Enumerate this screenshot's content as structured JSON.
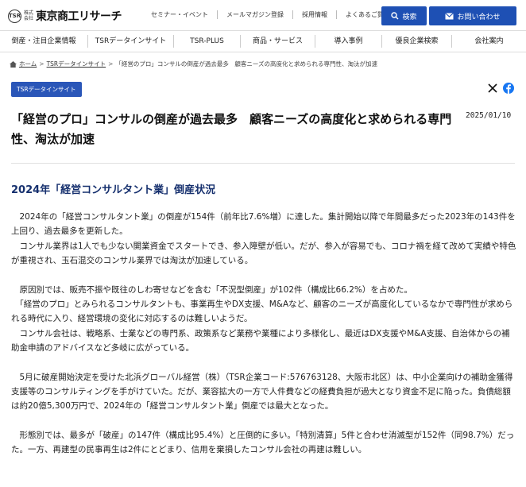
{
  "header": {
    "logo_mark": "TSR",
    "logo_small": "株式会社",
    "logo_text": "東京商工リサーチ",
    "links": [
      "セミナー・イベント",
      "メールマガジン登録",
      "採用情報",
      "よくあるご質問"
    ],
    "search_label": "検索",
    "contact_label": "お問い合わせ"
  },
  "nav": {
    "items": [
      "倒産・注目企業情報",
      "TSRデータインサイト",
      "TSR-PLUS",
      "商品・サービス",
      "導入事例",
      "優良企業検索",
      "会社案内"
    ]
  },
  "breadcrumb": {
    "home": "ホーム",
    "section": "TSRデータインサイト",
    "current": "「経営のプロ」コンサルの倒産が過去最多　顧客ニーズの高度化と求められる専門性、淘汰が加速"
  },
  "article": {
    "tag": "TSRデータインサイト",
    "title": "「経営のプロ」コンサルの倒産が過去最多　顧客ニーズの高度化と求められる専門性、淘汰が加速",
    "date": "2025/01/10",
    "heading": "2024年「経営コンサルタント業」倒産状況",
    "paragraphs": [
      "　2024年の「経営コンサルタント業」の倒産が154件（前年比7.6%増）に達した。集計開始以降で年間最多だった2023年の143件を上回り、過去最多を更新した。",
      "　コンサル業界は1人でも少ない開業資金でスタートでき、参入障壁が低い。だが、参入が容易でも、コロナ禍を経て改めて実績や特色が重視され、玉石混交のコンサル業界では淘汰が加速している。",
      "",
      "　原因別では、販売不振や既往のしわ寄せなどを含む「不況型倒産」が102件（構成比66.2%）を占めた。",
      "　「経営のプロ」とみられるコンサルタントも、事業再生やDX支援、M&Aなど、顧客のニーズが高度化しているなかで専門性が求められる時代に入り、経営環境の変化に対応するのは難しいようだ。",
      "　コンサル会社は、戦略系、士業などの専門系、政策系など業務や業種により多様化し、最近はDX支援やM&A支援、自治体からの補助金申請のアドバイスなど多岐に広がっている。",
      "",
      "　5月に破産開始決定を受けた北浜グローバル経営（株）（TSR企業コード:576763128、大阪市北区）は、中小企業向けの補助金獲得支援等のコンサルティングを手がけていた。だが、業容拡大の一方で人件費などの経費負担が過大となり資金不足に陥った。負債総額は約20億5,300万円で、2024年の「経営コンサルタント業」倒産では最大となった。",
      "",
      "　形態別では、最多が「破産」の147件（構成比95.4%）と圧倒的に多い。「特別清算」5件と合わせ消滅型が152件（同98.7%）だった。一方、再建型の民事再生は2件にとどまり、信用を棄損したコンサル会社の再建は難しい。"
    ]
  },
  "colors": {
    "brand_blue": "#1e50b4",
    "tag_blue": "#2a56b8",
    "heading_navy": "#16306e"
  }
}
